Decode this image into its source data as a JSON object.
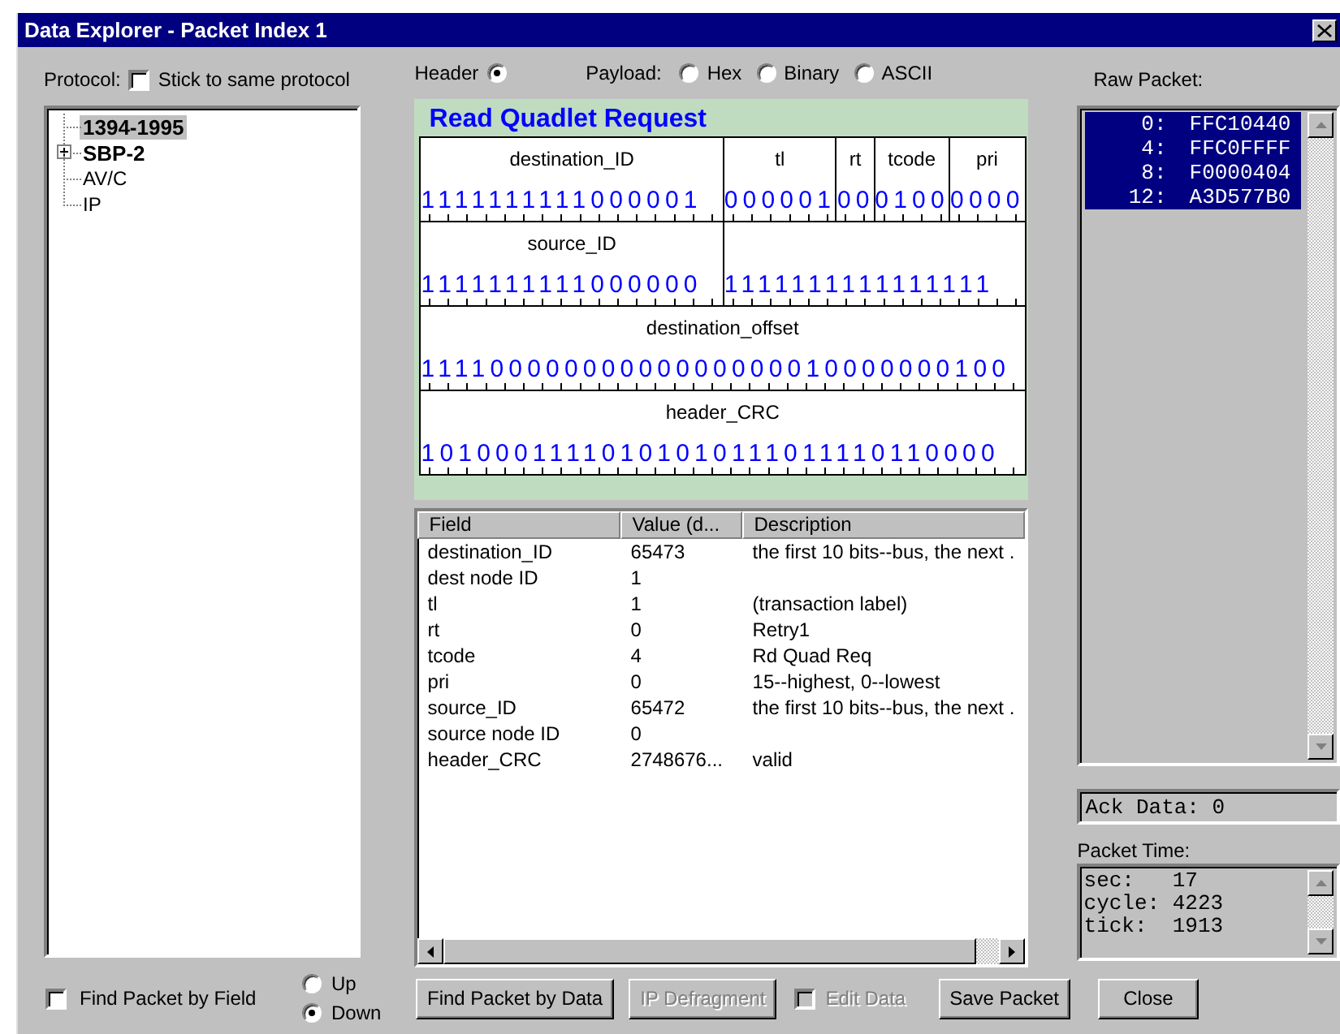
{
  "window": {
    "title": "Data Explorer - Packet Index 1"
  },
  "protocol": {
    "label": "Protocol:",
    "stick": {
      "label": "Stick to same protocol",
      "checked": false
    }
  },
  "tree": [
    {
      "label": "1394-1995",
      "bold": true,
      "selected": true,
      "collapsed": false
    },
    {
      "label": "SBP-2",
      "bold": true,
      "selected": false,
      "collapsed": true
    },
    {
      "label": "AV/C",
      "bold": false,
      "selected": false,
      "collapsed": false
    },
    {
      "label": "IP",
      "bold": false,
      "selected": false,
      "collapsed": false
    }
  ],
  "header_option": {
    "label": "Header",
    "selected": true
  },
  "payload": {
    "label": "Payload:",
    "options": [
      {
        "label": "Hex",
        "selected": false
      },
      {
        "label": "Binary",
        "selected": false
      },
      {
        "label": "ASCII",
        "selected": false
      }
    ]
  },
  "packet_diagram": {
    "title": "Read Quadlet Request",
    "rows": [
      [
        {
          "label": "destination_ID",
          "bits": "1111111111000001"
        },
        {
          "label": "tl",
          "bits": "000001"
        },
        {
          "label": "rt",
          "bits": "00"
        },
        {
          "label": "tcode",
          "bits": "0100"
        },
        {
          "label": "pri",
          "bits": "0000"
        }
      ],
      [
        {
          "label": "source_ID",
          "bits": "1111111111000000"
        },
        {
          "bits": "1111111111111111"
        }
      ],
      [
        {
          "label": "destination_offset",
          "bits": "11110000000000000000010000000100"
        }
      ],
      [
        {
          "label": "header_CRC",
          "bits": "10100011110101010111011110110000"
        }
      ]
    ]
  },
  "field_table": {
    "columns": [
      "Field",
      "Value (d...",
      "Description"
    ],
    "rows": [
      [
        "destination_ID",
        "65473",
        "the first 10 bits--bus, the next ."
      ],
      [
        "dest node ID",
        "1",
        ""
      ],
      [
        "tl",
        "1",
        "(transaction label)"
      ],
      [
        "rt",
        "0",
        "Retry1"
      ],
      [
        "tcode",
        "4",
        "Rd Quad Req"
      ],
      [
        "pri",
        "0",
        "15--highest, 0--lowest"
      ],
      [
        "source_ID",
        "65472",
        "the first 10 bits--bus, the next ."
      ],
      [
        "source node ID",
        "0",
        ""
      ],
      [
        "header_CRC",
        "2748676...",
        "valid"
      ]
    ]
  },
  "raw_packet": {
    "label": "Raw Packet:",
    "rows": [
      {
        "offset": "0:",
        "value": "FFC10440",
        "selected": true
      },
      {
        "offset": "4:",
        "value": "FFC0FFFF",
        "selected": true
      },
      {
        "offset": "8:",
        "value": "F0000404",
        "selected": true
      },
      {
        "offset": "12:",
        "value": "A3D577B0",
        "selected": true
      }
    ]
  },
  "ack_data": "Ack Data: 0",
  "packet_time": {
    "label": "Packet Time:",
    "lines": [
      {
        "name": "sec:",
        "value": "17"
      },
      {
        "name": "cycle:",
        "value": "4223"
      },
      {
        "name": "tick:",
        "value": "1913"
      }
    ]
  },
  "find_by_field": {
    "label": "Find Packet by Field",
    "checked": false
  },
  "direction": [
    {
      "label": "Up",
      "selected": false
    },
    {
      "label": "Down",
      "selected": true
    }
  ],
  "controls": [
    {
      "kind": "button",
      "label": "Find Packet by Data",
      "disabled": false
    },
    {
      "kind": "button",
      "label": "IP Defragment",
      "disabled": true
    },
    {
      "kind": "checkbox",
      "label": "Edit Data",
      "disabled": true,
      "checked": false
    },
    {
      "kind": "button",
      "label": "Save Packet",
      "disabled": false
    },
    {
      "kind": "button",
      "label": "Close",
      "disabled": false
    }
  ]
}
